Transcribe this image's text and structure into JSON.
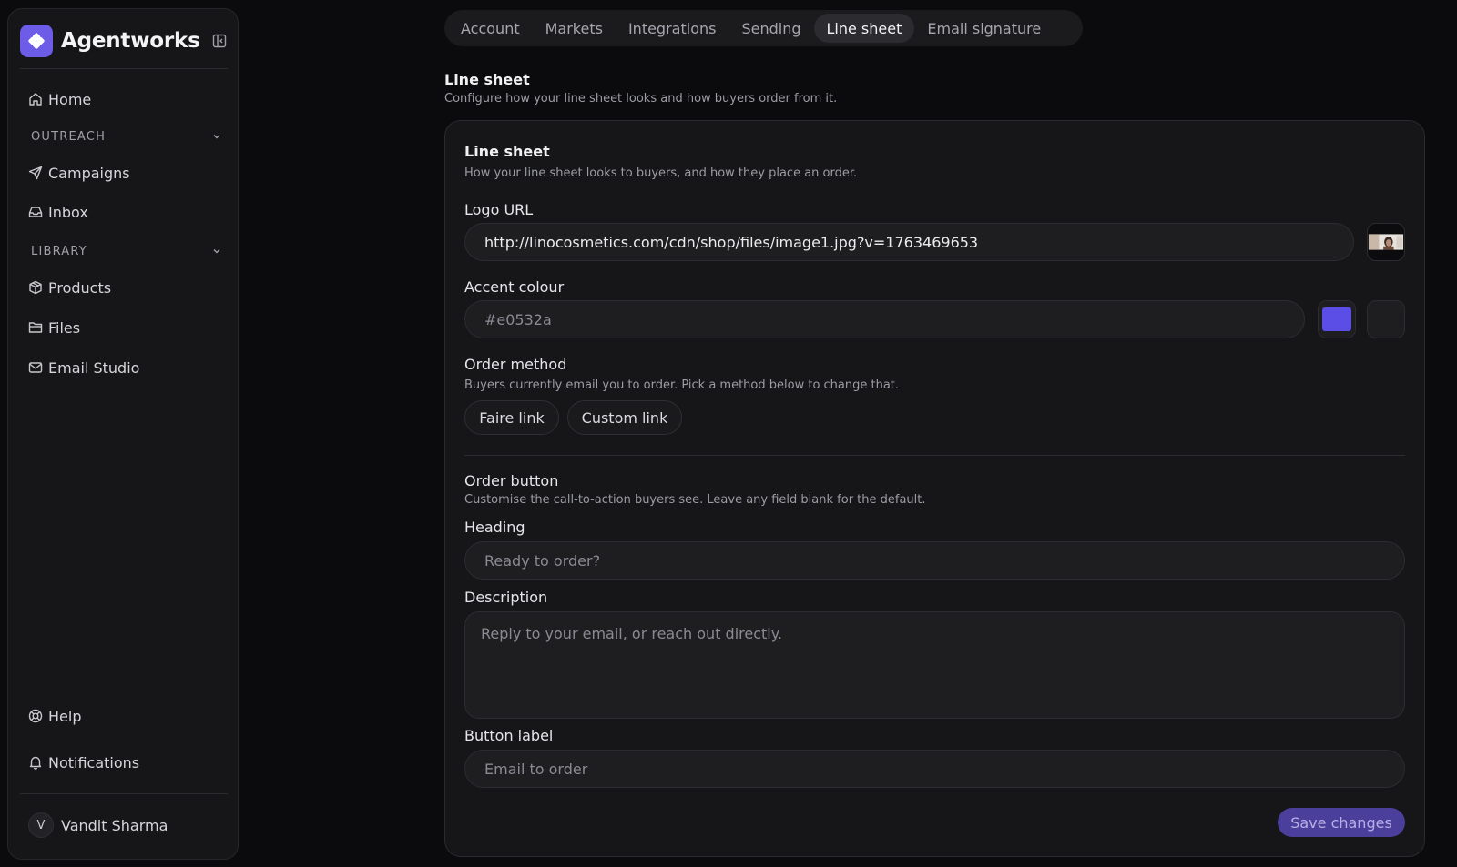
{
  "app": {
    "name": "Agentworks",
    "brand_color": "#6c5ce7"
  },
  "sidebar": {
    "home": "Home",
    "outreach_header": "OUTREACH",
    "campaigns": "Campaigns",
    "inbox": "Inbox",
    "library_header": "LIBRARY",
    "products": "Products",
    "files": "Files",
    "email_studio": "Email Studio",
    "help": "Help",
    "notifications": "Notifications",
    "user": {
      "initial": "V",
      "name": "Vandit Sharma"
    }
  },
  "tabs": [
    {
      "label": "Account",
      "active": false
    },
    {
      "label": "Markets",
      "active": false
    },
    {
      "label": "Integrations",
      "active": false
    },
    {
      "label": "Sending",
      "active": false
    },
    {
      "label": "Line sheet",
      "active": true
    },
    {
      "label": "Email signature",
      "active": false
    }
  ],
  "page": {
    "title": "Line sheet",
    "subtitle": "Configure how your line sheet looks and how buyers order from it."
  },
  "card": {
    "title": "Line sheet",
    "subtitle": "How your line sheet looks to buyers, and how they place an order.",
    "logo_url": {
      "label": "Logo URL",
      "value": "http://linocosmetics.com/cdn/shop/files/image1.jpg?v=1763469653"
    },
    "accent": {
      "label": "Accent colour",
      "placeholder": "#e0532a",
      "swatch_color": "#5b4ee6"
    },
    "order_method": {
      "label": "Order method",
      "hint": "Buyers currently email you to order. Pick a method below to change that.",
      "options": [
        "Faire link",
        "Custom link"
      ]
    },
    "order_button": {
      "title": "Order button",
      "hint": "Customise the call-to-action buyers see. Leave any field blank for the default.",
      "heading_label": "Heading",
      "heading_placeholder": "Ready to order?",
      "description_label": "Description",
      "description_placeholder": "Reply to your email, or reach out directly.",
      "button_label_label": "Button label",
      "button_label_placeholder": "Email to order"
    },
    "save_label": "Save changes"
  }
}
